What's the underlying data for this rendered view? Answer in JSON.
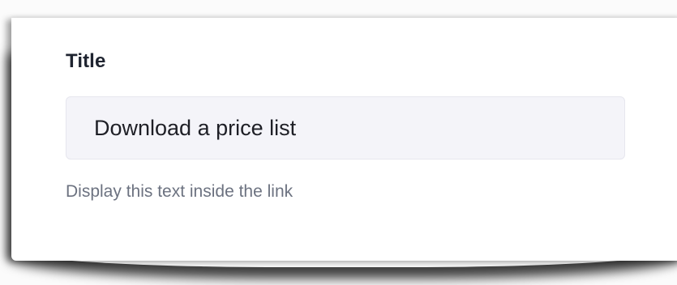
{
  "form": {
    "title_label": "Title",
    "title_value": "Download a price list",
    "help_text": "Display this text inside the link"
  },
  "colors": {
    "label": "#1f2430",
    "input_background": "#f4f4f9",
    "help_text": "#6c7280"
  }
}
